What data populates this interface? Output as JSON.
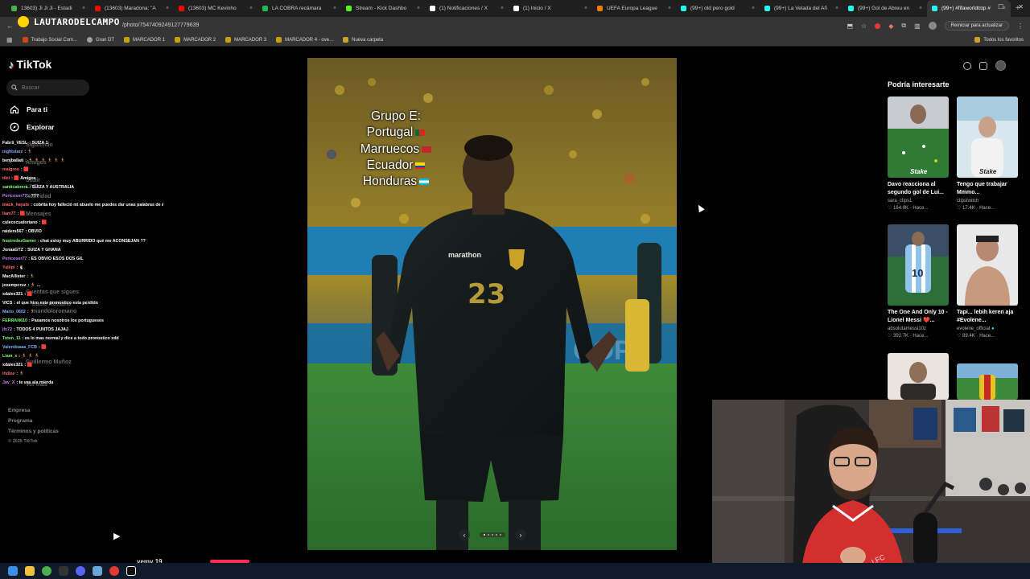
{
  "browser": {
    "tabs": [
      {
        "title": "13603) Ji Ji Ji - Estadi",
        "color": "#4caf50"
      },
      {
        "title": "(13603) Maradona: \"A",
        "color": "#ff0000"
      },
      {
        "title": "(13603) MC Kevinho",
        "color": "#ff0000"
      },
      {
        "title": "LA COBRA recámara",
        "color": "#1db954"
      },
      {
        "title": "Stream - Kick Dashbo",
        "color": "#53fc18"
      },
      {
        "title": "(1) Notificaciones / X",
        "color": "#ffffff"
      },
      {
        "title": "(1) Inicio / X",
        "color": "#ffffff"
      },
      {
        "title": "UEFA Europa League",
        "color": "#f57c00"
      },
      {
        "title": "(99+) old pero gold ",
        "color": "#25f4ee"
      },
      {
        "title": "(99+) La Velada del Añ",
        "color": "#25f4ee"
      },
      {
        "title": "(99+) Gol de Abreu en",
        "color": "#25f4ee"
      },
      {
        "title": "(99+) #fifaworldcup #",
        "color": "#25f4ee"
      }
    ],
    "url": "/photo/7547409249127779639",
    "update_button": "Reiniciar para actualizar",
    "bookmarks": [
      {
        "label": "Trabajo Social Com...",
        "kind": "orange"
      },
      {
        "label": "Gran DT",
        "kind": "grey"
      },
      {
        "label": "MARCADOR 1",
        "kind": "gold"
      },
      {
        "label": "MARCADOR 2",
        "kind": "gold"
      },
      {
        "label": "MARCADOR 3",
        "kind": "gold"
      },
      {
        "label": "MARCADOR 4 - ove...",
        "kind": "gold"
      },
      {
        "label": "Nueva carpeta",
        "kind": "folder"
      }
    ],
    "all_bookmarks": "Todos los favoritos"
  },
  "overlay_brand": "LAUTARODELCAMPO",
  "tiktok": {
    "logo": "TikTok",
    "search_placeholder": "Buscar",
    "nav": [
      {
        "label": "Para ti",
        "icon": "home-icon"
      },
      {
        "label": "Explorar",
        "icon": "compass-icon"
      }
    ],
    "ghost_labels": [
      "Siguiendo",
      "Amigos",
      "Subir",
      "LIVE",
      "Actividad",
      "Mensajes",
      "Cuentas que sigues",
      "Lucio Romano",
      "mundoloromano",
      "Guillermo Muñoz",
      "Ver más"
    ],
    "footer": [
      "Empresa",
      "Programa",
      "Términos y políticas"
    ],
    "copyright": "© 2025 TikTok",
    "bottom_username": "yemy 19",
    "post": {
      "caption_lines": [
        {
          "text": "Grupo E:",
          "flag": ""
        },
        {
          "text": "Portugal",
          "flag": "pt"
        },
        {
          "text": "Marruecos",
          "flag": "ma"
        },
        {
          "text": "Ecuador",
          "flag": "ec"
        },
        {
          "text": "Honduras",
          "flag": "hn"
        }
      ],
      "jersey_brand": "marathon",
      "jersey_number": "23",
      "sponsor_text": "COPA"
    },
    "suggestions_title": "Podría interesarte",
    "suggestions": [
      {
        "title": "Davo reacciona al segundo gol de Lui...",
        "user": "sara_clips1",
        "likes": "164.9K",
        "time": "Hace..."
      },
      {
        "title": "Tengo que trabajar Mmmo...",
        "user": "clipstwitch",
        "likes": "17.4K",
        "time": "Hace..."
      },
      {
        "title": "The One And Only 10 - Lionel Messi ❤️...",
        "user": "absolutamessi10z",
        "likes": "392.7K",
        "time": "Hace..."
      },
      {
        "title": "Tapi... lebih keren aja #Evolene...",
        "user": "evolene_official",
        "likes": "89.4K",
        "time": "Hace..."
      }
    ],
    "thumb_badges": [
      "Stake",
      "Stake"
    ]
  },
  "chat": [
    {
      "user": "Fabrii_VESL",
      "color": "#ffffff",
      "msg": ": SUIZA 1"
    },
    {
      "user": "nightstarz",
      "color": "#7cb3ff",
      "msg": ": 🏃"
    },
    {
      "user": "benjballati",
      "color": "#ffffff",
      "msg": ": 🏃 🏃 🏃 🏃 🏃 🏃"
    },
    {
      "user": "maigroo",
      "color": "#ff6b6b",
      "msg": ": 🟥"
    },
    {
      "user": "tikii",
      "color": "#ff6b6b",
      "msg": ": 🟥 Amigos"
    },
    {
      "user": "santicabrera",
      "color": "#7cff7c",
      "msg": ": SUIZA Y AUSTRALIA"
    },
    {
      "user": "Pericosor77",
      "color": "#c084fc",
      "msg": ": ???"
    },
    {
      "user": "black_hayate",
      "color": "#ff6b6b",
      "msg": ": cobrita hoy falleció mi abuelo me puedes dar unas palabras de ánimo"
    },
    {
      "user": "liam77",
      "color": "#ff6b6b",
      "msg": ": 🟥"
    },
    {
      "user": "culececuatoriano",
      "color": "#ffffff",
      "msg": ": 🟥"
    },
    {
      "user": "raiders567",
      "color": "#ffffff",
      "msg": ": OBVIO"
    },
    {
      "user": "frasiredezGamer",
      "color": "#7cff7c",
      "msg": ": chat estoy muy ABURRIDO qué me ACONSEJAN ??"
    },
    {
      "user": "JonaaGTZ",
      "color": "#ffffff",
      "msg": ": SUIZA Y GHANA"
    },
    {
      "user": "Pericosor77",
      "color": "#c084fc",
      "msg": ": ES OBVIO ESOS DOS GIL"
    },
    {
      "user": "Yaliipi",
      "color": "#ff6b6b",
      "msg": ": 🐧"
    },
    {
      "user": "MacAllister",
      "color": "#ffffff",
      "msg": ": 🏃"
    },
    {
      "user": "josempcruz",
      "color": "#ffffff",
      "msg": ": 🏃 ..."
    },
    {
      "user": "xdalex321",
      "color": "#ffffff",
      "msg": ": 🟥"
    },
    {
      "user": "VICS",
      "color": "#ffffff",
      "msg": ": el que hizo este pronostico esta perdido"
    },
    {
      "user": "Mario_0602",
      "color": "#7cb3ff",
      "msg": ": 🏃"
    },
    {
      "user": "FERRAN610",
      "color": "#7cff7c",
      "msg": ": Pasamos nosotros los portugueses"
    },
    {
      "user": "jfc72",
      "color": "#c084fc",
      "msg": ": TODOS 4 PUNTOS JAJAJ"
    },
    {
      "user": "Toten_11",
      "color": "#7cff7c",
      "msg": ": es lo mas normal y dice a todo pronostico xdd"
    },
    {
      "user": "Valentinaaa_FCB",
      "color": "#7cb3ff",
      "msg": ": 🟥"
    },
    {
      "user": "Liam_x",
      "color": "#7cff7c",
      "msg": ": 🏃 🏃 🏃"
    },
    {
      "user": "xdalex321",
      "color": "#ffffff",
      "msg": ": 🟥"
    },
    {
      "user": "ihdixe",
      "color": "#ff6b6b",
      "msg": ": 🏃"
    },
    {
      "user": "Jav_X",
      "color": "#c084fc",
      "msg": ": te vas ala mierda"
    }
  ]
}
